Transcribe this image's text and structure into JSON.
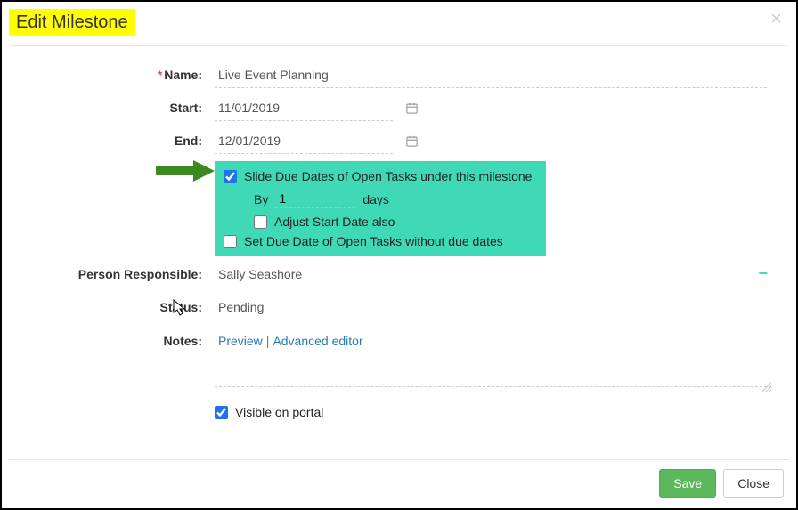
{
  "dialog": {
    "title": "Edit Milestone",
    "close_glyph": "×"
  },
  "form": {
    "name_label": "Name:",
    "name_value": "Live Event Planning",
    "start_label": "Start:",
    "start_value": "11/01/2019",
    "end_label": "End:",
    "end_value": "12/01/2019",
    "slide_cb_label": "Slide Due Dates of Open Tasks under this milestone",
    "slide_cb_checked": true,
    "by_label": "By",
    "by_value": "1",
    "by_unit": "days",
    "adjust_label": "Adjust Start Date also",
    "adjust_checked": false,
    "setdue_label": "Set Due Date of Open Tasks without due dates",
    "setdue_checked": false,
    "person_label": "Person Responsible:",
    "person_value": "Sally Seashore",
    "status_label": "Status:",
    "status_value": "Pending",
    "notes_label": "Notes:",
    "notes_preview": "Preview",
    "notes_advanced": "Advanced editor",
    "visible_label": "Visible on portal",
    "visible_checked": true
  },
  "footer": {
    "save": "Save",
    "close": "Close"
  },
  "required_mark": "*"
}
